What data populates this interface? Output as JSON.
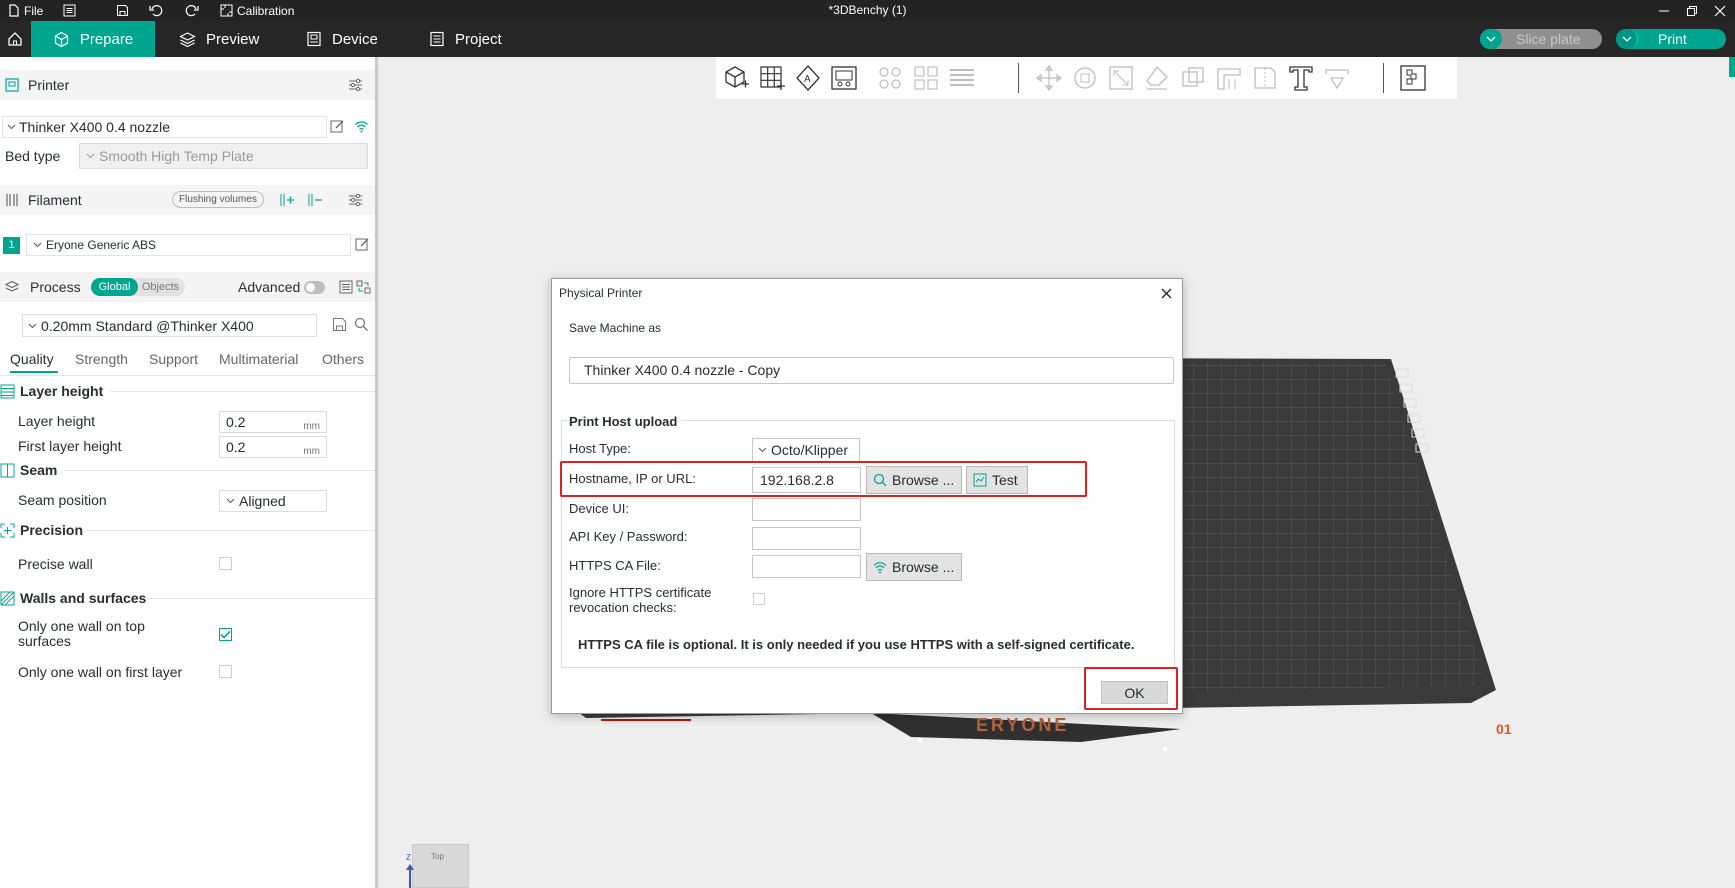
{
  "window": {
    "menu_file": "File",
    "calibration": "Calibration",
    "title": "*3DBenchy (1)"
  },
  "nav": {
    "tabs": [
      {
        "label": "Prepare"
      },
      {
        "label": "Preview"
      },
      {
        "label": "Device"
      },
      {
        "label": "Project"
      }
    ],
    "slice_plate": "Slice plate",
    "print": "Print"
  },
  "printer": {
    "section": "Printer",
    "selected": "Thinker X400 0.4 nozzle",
    "bed_type_label": "Bed type",
    "bed_type_value": "Smooth High Temp Plate"
  },
  "filament": {
    "section": "Filament",
    "flushing_volumes": "Flushing volumes",
    "slot_number": "1",
    "selected": "Eryone Generic ABS"
  },
  "process": {
    "section": "Process",
    "toggle_global": "Global",
    "toggle_objects": "Objects",
    "advanced": "Advanced",
    "profile": "0.20mm Standard @Thinker X400",
    "tabs": [
      "Quality",
      "Strength",
      "Support",
      "Multimaterial",
      "Others"
    ]
  },
  "settings": {
    "layer_height_group": "Layer height",
    "layer_height_label": "Layer height",
    "layer_height_value": "0.2",
    "first_layer_height_label": "First layer height",
    "first_layer_height_value": "0.2",
    "unit_mm": "mm",
    "seam_group": "Seam",
    "seam_position_label": "Seam position",
    "seam_position_value": "Aligned",
    "precision_group": "Precision",
    "precise_wall_label": "Precise wall",
    "precise_wall_checked": false,
    "walls_group": "Walls and surfaces",
    "one_wall_top_label": "Only one wall on top surfaces",
    "one_wall_top_checked": true,
    "one_wall_first_label": "Only one wall on first layer",
    "one_wall_first_checked": false
  },
  "viewport": {
    "bed_brand": "ERYONE",
    "plate_number": "01",
    "cube_label": "Top",
    "axis_label": "Z"
  },
  "dialog": {
    "title": "Physical Printer",
    "save_as_label": "Save Machine as",
    "save_as_value": "Thinker X400 0.4 nozzle - Copy",
    "group_title": "Print Host upload",
    "host_type_label": "Host Type:",
    "host_type_value": "Octo/Klipper",
    "hostname_label": "Hostname, IP or URL:",
    "hostname_value": "192.168.2.8",
    "browse_label": "Browse ...",
    "test_label": "Test",
    "device_ui_label": "Device UI:",
    "device_ui_value": "",
    "api_key_label": "API Key / Password:",
    "api_key_value": "",
    "ca_file_label": "HTTPS CA File:",
    "ca_file_value": "",
    "ca_browse_label": "Browse ...",
    "ignore_revocation_label": "Ignore HTTPS certificate revocation checks:",
    "ignore_revocation_checked": false,
    "note": "HTTPS CA file is optional. It is only needed if you use HTTPS with a self-signed certificate.",
    "ok_label": "OK"
  },
  "colors": {
    "accent": "#00a58f",
    "titlebar": "#232323",
    "navbar": "#262626",
    "highlight": "#e02020"
  }
}
